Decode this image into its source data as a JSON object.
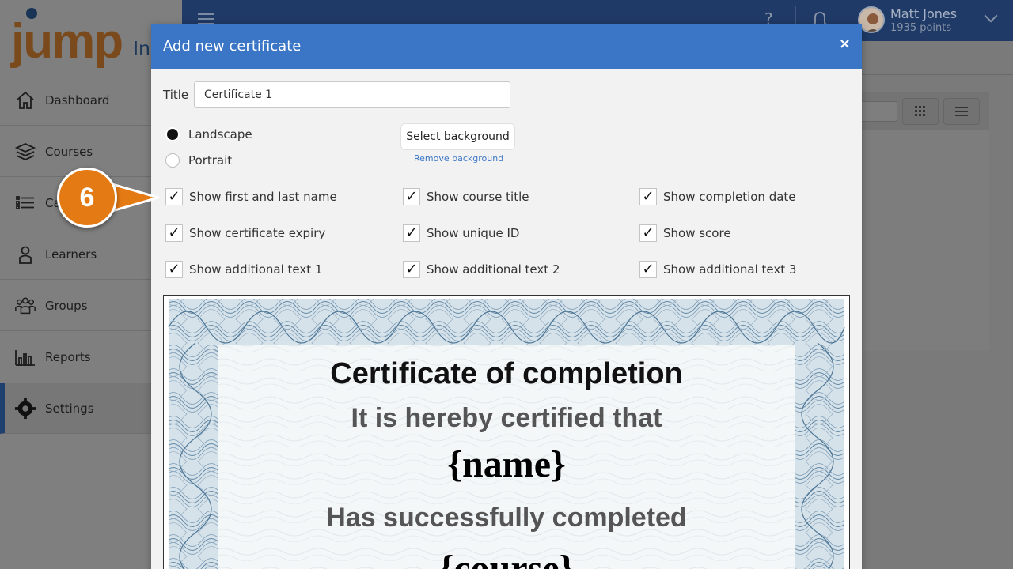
{
  "app": {
    "logo_text": "jump",
    "logo_text_suffix": "In"
  },
  "sidebar": {
    "items": [
      {
        "label": "Dashboard",
        "icon": "home-icon"
      },
      {
        "label": "Courses",
        "icon": "stack-icon"
      },
      {
        "label": "Ca",
        "icon": "list-icon"
      },
      {
        "label": "Learners",
        "icon": "person-icon"
      },
      {
        "label": "Groups",
        "icon": "group-icon"
      },
      {
        "label": "Reports",
        "icon": "bar-chart-icon"
      },
      {
        "label": "Settings",
        "icon": "gear-icon",
        "active": true
      }
    ]
  },
  "topbar": {
    "user_name": "Matt Jones",
    "user_points": "1935 points"
  },
  "modal": {
    "title": "Add new certificate",
    "close_symbol": "×",
    "title_label": "Title",
    "title_value": "Certificate 1",
    "orientation": {
      "landscape_label": "Landscape",
      "portrait_label": "Portrait",
      "selected": "Landscape"
    },
    "select_background_label": "Select background",
    "remove_background_label": "Remove background",
    "options": [
      {
        "label": "Show first and last name",
        "checked": true
      },
      {
        "label": "Show course title",
        "checked": true
      },
      {
        "label": "Show completion date",
        "checked": true
      },
      {
        "label": "Show certificate expiry",
        "checked": true
      },
      {
        "label": "Show unique ID",
        "checked": true
      },
      {
        "label": "Show score",
        "checked": true
      },
      {
        "label": "Show additional text 1",
        "checked": true
      },
      {
        "label": "Show additional text 2",
        "checked": true
      },
      {
        "label": "Show additional text 3",
        "checked": true
      }
    ],
    "check_mark": "✓",
    "certificate": {
      "heading": "Certificate of completion",
      "line1": "It is hereby certified that",
      "name_placeholder": "{name}",
      "line2": "Has successfully completed",
      "course_placeholder": "{course}"
    }
  },
  "callout": {
    "number": "6",
    "color": "#e47a14"
  },
  "colors": {
    "modal_header": "#3b76c6",
    "topbar": "#1f3a66",
    "accent_link": "#3b76c6"
  }
}
